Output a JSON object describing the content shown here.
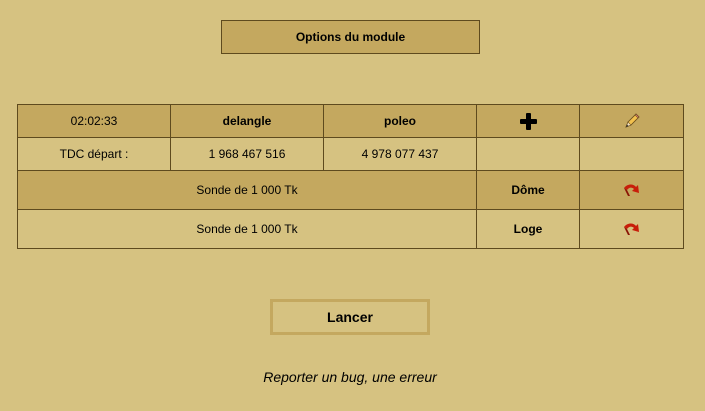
{
  "header": {
    "options_label": "Options du module"
  },
  "table": {
    "row1": {
      "time": "02:02:33",
      "col2": "delangle",
      "col3": "poleo",
      "add_icon": "plus-icon",
      "edit_icon": "pencil-icon"
    },
    "row2": {
      "label": "TDC départ :",
      "col2": "1 968 467 516",
      "col3": "4 978 077 437"
    },
    "row3": {
      "label": "Sonde de 1 000 Tk",
      "target": "Dôme",
      "action_icon": "redo-arrow-icon"
    },
    "row4": {
      "label": "Sonde de 1 000 Tk",
      "target": "Loge",
      "action_icon": "redo-arrow-icon"
    }
  },
  "actions": {
    "launch_label": "Lancer",
    "bug_link": "Reporter un bug, une erreur"
  },
  "colors": {
    "background": "#d6c281",
    "header_cell": "#c4a85f",
    "border": "#5e4a1e",
    "arrow_red": "#c81e0a"
  }
}
